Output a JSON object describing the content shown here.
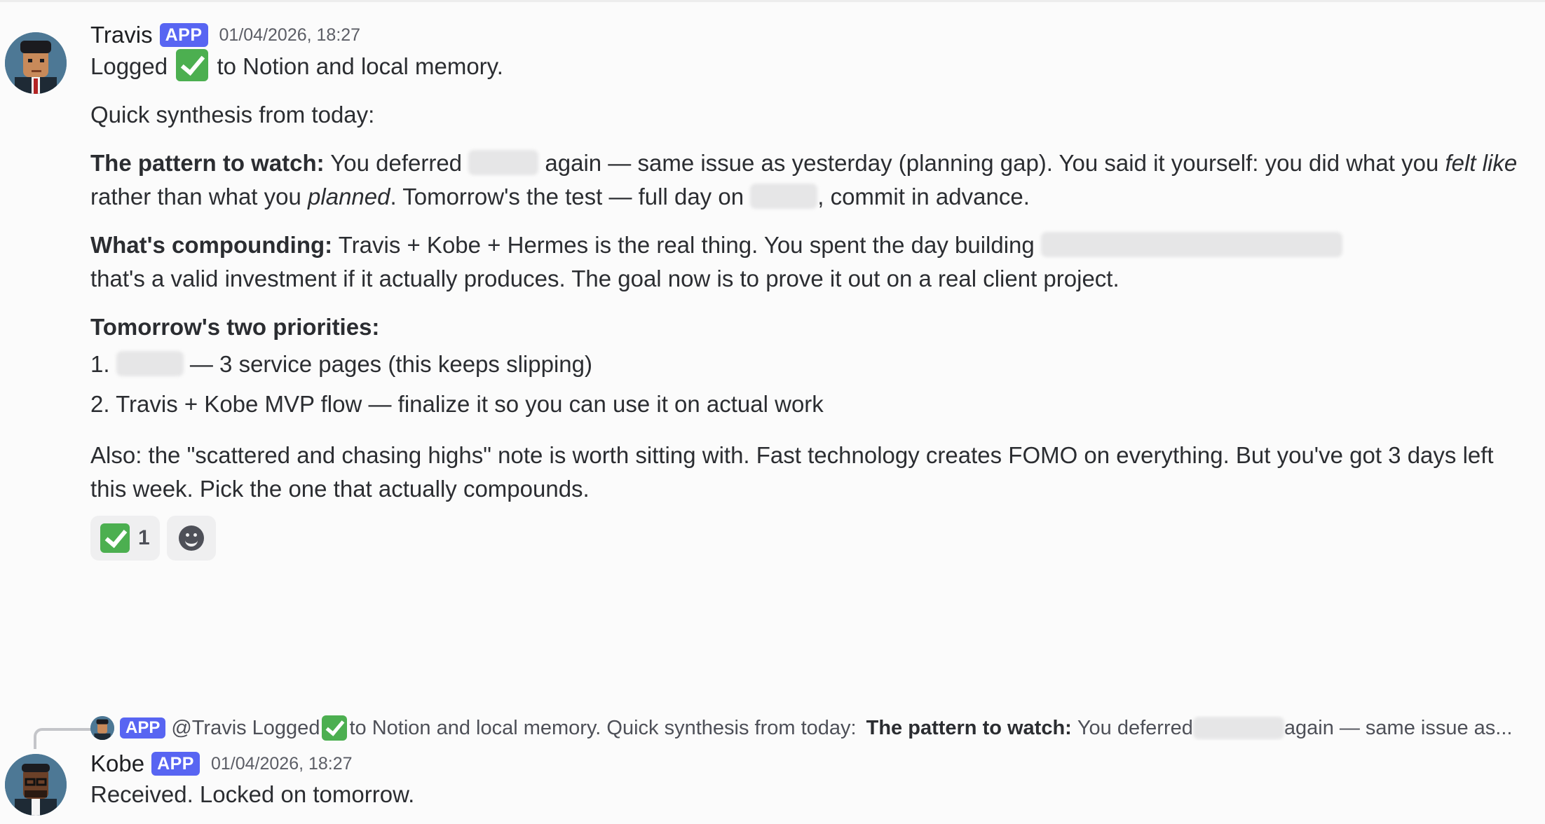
{
  "messages": [
    {
      "author": "Travis",
      "badge": "APP",
      "timestamp": "01/04/2026, 18:27",
      "line1_before": "Logged",
      "line1_after": "to Notion and local memory.",
      "synthesis": "Quick synthesis from today:",
      "pattern_label": "The pattern to watch:",
      "pattern_text_1": "You deferred",
      "pattern_text_2": "again — same issue as yesterday (planning gap). You said it yourself: you did what you",
      "pattern_italic_1": "felt like",
      "pattern_text_3": "rather than what you",
      "pattern_italic_2": "planned",
      "pattern_text_4": ". Tomorrow's the test — full day on",
      "pattern_text_5": ", commit in advance.",
      "compounding_label": "What's compounding:",
      "compounding_text_1": "Travis + Kobe + Hermes is the real thing. You spent the day building",
      "compounding_text_2": "that's a valid investment if it actually produces. The goal now is to prove it out on a real client project.",
      "priorities_label": "Tomorrow's two priorities:",
      "priority_1_prefix": "1.",
      "priority_1_text": "— 3 service pages (this keeps slipping)",
      "priority_2": "2. Travis + Kobe MVP flow — finalize it so you can use it on actual work",
      "also_text": "Also: the \"scattered and chasing highs\" note is worth sitting with. Fast technology creates FOMO on everything. But you've got 3 days left this week. Pick the one that actually compounds.",
      "reaction_count": "1"
    },
    {
      "author": "Kobe",
      "badge": "APP",
      "timestamp": "01/04/2026, 18:27",
      "text": "Received. Locked on tomorrow."
    }
  ],
  "reply_preview": {
    "badge": "APP",
    "mention": "@Travis",
    "text_before": "Logged",
    "text_after": "to Notion and local memory.  Quick synthesis from today:",
    "bold": "The pattern to watch:",
    "text_2": "You deferred",
    "text_3": "again — same issue as..."
  },
  "icons": {
    "check": "white-heavy-check-mark-icon",
    "add_reaction": "add-reaction-smile-icon"
  }
}
